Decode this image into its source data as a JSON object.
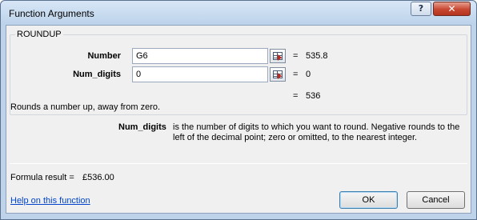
{
  "window": {
    "title": "Function Arguments",
    "help_glyph": "?",
    "close_glyph": "✕"
  },
  "function": {
    "name": "ROUNDUP",
    "args": [
      {
        "label": "Number",
        "input": "G6",
        "result": "535.8"
      },
      {
        "label": "Num_digits",
        "input": "0",
        "result": "0"
      }
    ],
    "equals": "=",
    "result": "536",
    "description": "Rounds a number up, away from zero.",
    "param_name": "Num_digits",
    "param_description": "is the number of digits to which you want to round. Negative rounds to the left of the decimal point; zero or omitted, to the nearest integer."
  },
  "formula": {
    "label": "Formula result =",
    "value": "£536.00"
  },
  "footer": {
    "help_link": "Help on this function",
    "ok_label": "OK",
    "cancel_label": "Cancel"
  },
  "colors": {
    "frame": "#bed3ea",
    "client": "#f0f0f0",
    "close_button": "#c84731",
    "link": "#0044cc"
  },
  "icons": [
    "help-icon",
    "close-icon",
    "collapse-dialog-icon"
  ]
}
